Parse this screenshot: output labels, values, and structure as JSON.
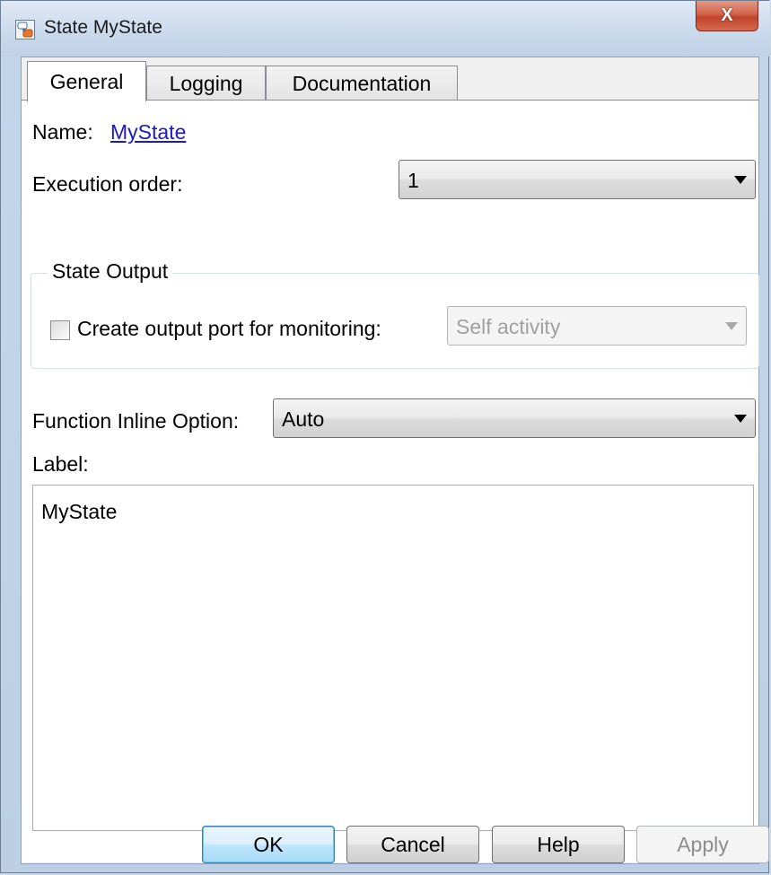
{
  "window": {
    "title": "State MyState",
    "close_glyph": "X"
  },
  "tabs": [
    {
      "label": "General",
      "active": true
    },
    {
      "label": "Logging",
      "active": false
    },
    {
      "label": "Documentation",
      "active": false
    }
  ],
  "general": {
    "name_label": "Name:",
    "name_value": "MyState",
    "execution_order_label": "Execution order:",
    "execution_order_value": "1",
    "state_output_group": "State Output",
    "create_output_port_label": "Create output port for monitoring:",
    "create_output_port_checked": false,
    "monitoring_value": "Self activity",
    "function_inline_label": "Function Inline Option:",
    "function_inline_value": "Auto",
    "label_label": "Label:",
    "label_value": "MyState"
  },
  "buttons": {
    "ok": "OK",
    "cancel": "Cancel",
    "help": "Help",
    "apply": "Apply"
  },
  "colors": {
    "link": "#1a19c8",
    "close_button": "#c0432b",
    "default_button_border": "#3c7fb1"
  },
  "icons": [
    "stateflow-state-icon",
    "close-icon",
    "dropdown-arrow-icon",
    "checkbox-icon"
  ]
}
